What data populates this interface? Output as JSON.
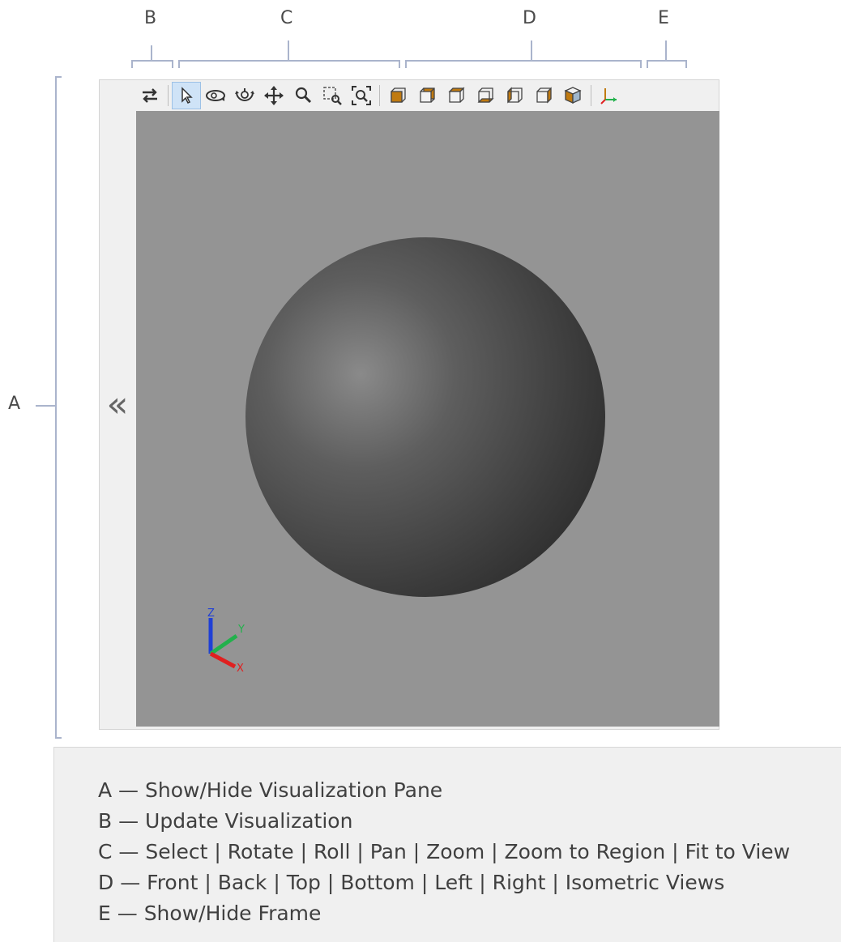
{
  "callouts": {
    "a": "A",
    "b": "B",
    "c": "C",
    "d": "D",
    "e": "E"
  },
  "toolbar": {
    "update": {
      "icon": "update-visualization-icon"
    },
    "select": {
      "icon": "select-arrow-icon",
      "active": true
    },
    "rotate": {
      "icon": "rotate-icon"
    },
    "roll": {
      "icon": "roll-icon"
    },
    "pan": {
      "icon": "pan-icon"
    },
    "zoom": {
      "icon": "zoom-icon"
    },
    "zoom_region": {
      "icon": "zoom-to-region-icon"
    },
    "fit_view": {
      "icon": "fit-to-view-icon"
    },
    "front": {
      "icon": "front-view-icon"
    },
    "back": {
      "icon": "back-view-icon"
    },
    "top": {
      "icon": "top-view-icon"
    },
    "bottom": {
      "icon": "bottom-view-icon"
    },
    "left": {
      "icon": "left-view-icon"
    },
    "right": {
      "icon": "right-view-icon"
    },
    "isometric": {
      "icon": "isometric-view-icon"
    },
    "frame": {
      "icon": "show-hide-frame-icon"
    }
  },
  "pane": {
    "collapse_glyph": "«"
  },
  "triad": {
    "z": "Z",
    "y": "Y",
    "x": "X",
    "colors": {
      "x": "#e02020",
      "y": "#22b14c",
      "z": "#1f3fd6"
    }
  },
  "legend": {
    "a": "A — Show/Hide Visualization Pane",
    "b": "B — Update Visualization",
    "c": "C — Select | Rotate | Roll | Pan | Zoom | Zoom to Region | Fit to View",
    "d": "D — Front | Back | Top | Bottom | Left | Right | Isometric Views",
    "e": "E — Show/Hide Frame"
  },
  "colors": {
    "canvas": "#949494",
    "bracket": "#aab4cc",
    "view_cube": "#c07a10",
    "active_tool": "#cfe3f7"
  }
}
